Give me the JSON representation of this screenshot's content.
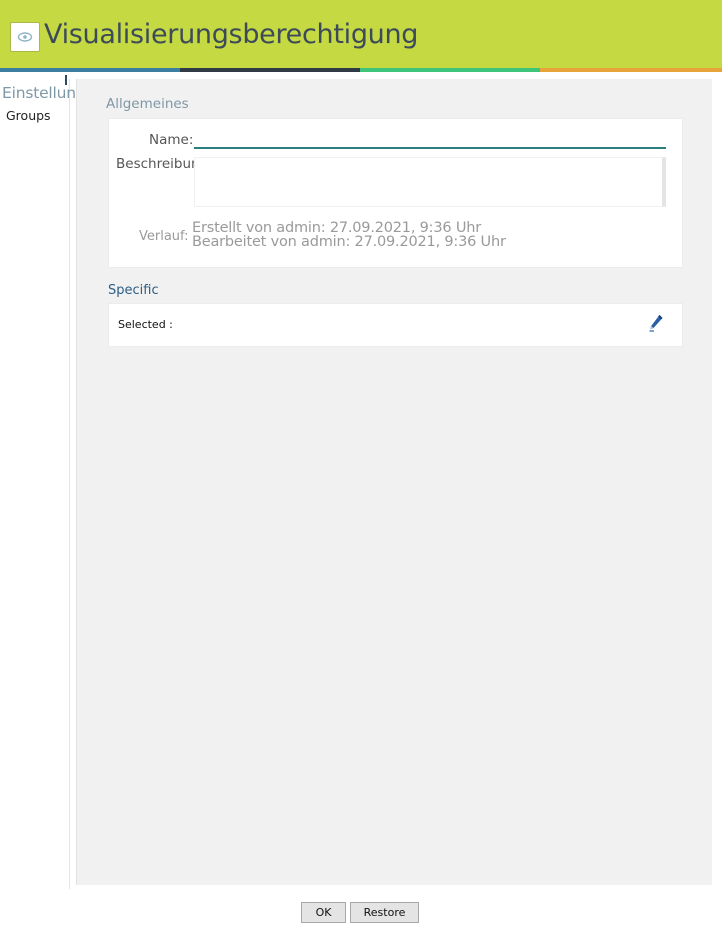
{
  "header": {
    "title": "Visualisierungsberechtigung",
    "icon": "eye-icon",
    "stripe_colors": [
      "#3b7ea0",
      "#2f3a44",
      "#3fc57a",
      "#e8a33a"
    ]
  },
  "sidebar": {
    "section": "Einstellungen",
    "items": [
      {
        "label": "Groups"
      }
    ]
  },
  "general": {
    "heading": "Allgemeines",
    "name_label": "Name:",
    "name_value": "",
    "description_label": "Beschreibung:",
    "description_value": "",
    "history_label": "Verlauf:",
    "created": "Erstellt von admin: 27.09.2021, 9:36 Uhr",
    "modified": "Bearbeitet von admin: 27.09.2021, 9:36 Uhr"
  },
  "specific": {
    "heading": "Specific",
    "selected_label": "Selected :",
    "edit_icon": "pencil-icon"
  },
  "footer": {
    "ok_label": "OK",
    "restore_label": "Restore"
  },
  "colors": {
    "header_bg": "#c4d942",
    "accent_teal": "#2a7e7e",
    "section_heading_gray": "#7f98a6",
    "specific_heading": "#2c5e84"
  }
}
